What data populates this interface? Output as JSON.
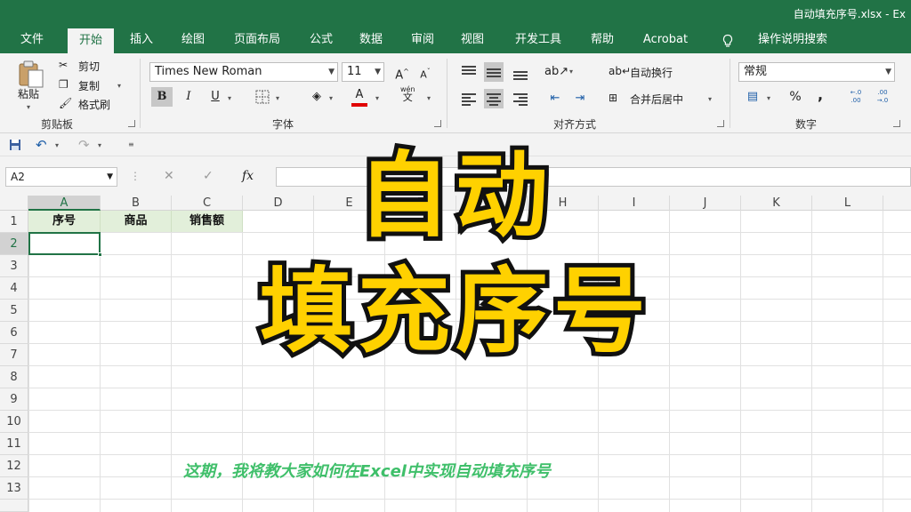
{
  "window": {
    "title": "自动填充序号.xlsx - Ex"
  },
  "tabs": [
    "文件",
    "开始",
    "插入",
    "绘图",
    "页面布局",
    "公式",
    "数据",
    "审阅",
    "视图",
    "开发工具",
    "帮助",
    "Acrobat"
  ],
  "tab_active": "开始",
  "tell_me": "操作说明搜索",
  "ribbon": {
    "clipboard": {
      "paste": "粘贴",
      "cut": "剪切",
      "copy": "复制",
      "format_painter": "格式刷",
      "label": "剪贴板"
    },
    "font": {
      "name": "Times New Roman",
      "size": "11",
      "grow": "A",
      "shrink": "A",
      "bold": "B",
      "italic": "I",
      "underline": "U",
      "label": "字体",
      "phonetic": "wén",
      "phonetic_char": "文"
    },
    "alignment": {
      "wrap": "自动换行",
      "merge": "合并后居中",
      "label": "对齐方式"
    },
    "number": {
      "format": "常规",
      "percent": "%",
      "comma": ",",
      "label": "数字",
      "inc_decimal": "←.0 .00",
      "dec_decimal": ".00 →.0"
    }
  },
  "formula_bar": {
    "name_box": "A2",
    "cancel": "✕",
    "enter": "✓",
    "fx": "fx"
  },
  "grid": {
    "columns": [
      "A",
      "B",
      "C",
      "D",
      "E",
      "F",
      "G",
      "H",
      "I",
      "J",
      "K",
      "L"
    ],
    "rows": [
      "1",
      "2",
      "3",
      "4",
      "5",
      "6",
      "7",
      "8",
      "9",
      "10",
      "11",
      "12",
      "13"
    ],
    "header_cells": [
      "序号",
      "商品",
      "销售额"
    ]
  },
  "overlay": {
    "line1": "自动",
    "line2": "填充序号",
    "subtitle": "这期，我将教大家如何在Excel中实现自动填充序号"
  },
  "colors": {
    "excel_green": "#217346",
    "headline_yellow": "#ffd100",
    "subtitle_green": "#3fbf6a",
    "header_fill": "#e2efda"
  }
}
